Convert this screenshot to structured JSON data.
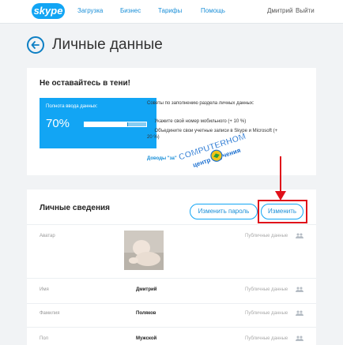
{
  "brand": {
    "logo_text": "skype"
  },
  "nav": {
    "items": [
      "Загрузка",
      "Бизнес",
      "Тарифы",
      "Помощь"
    ],
    "user": "Дмитрий",
    "logout": "Выйти"
  },
  "page": {
    "title": "Личные данные"
  },
  "completion": {
    "heading": "Не оставайтесь в тени!",
    "label": "Полнота ввода данных:",
    "percent_text": "70%",
    "percent": 0.7,
    "tips_title": "Советы по заполнению раздела личных данных:",
    "tips": [
      "Укажите свой номер мобильного (+ 10 %)",
      "Объедините свои учетные записи в Skype и Microsoft (+ 20 %)"
    ],
    "link": "Доводы \"за\""
  },
  "watermark": {
    "line1": "COMPUTERHOM",
    "line2": "центр обучения"
  },
  "profile": {
    "title": "Личные сведения",
    "change_password": "Изменить пароль",
    "edit": "Изменить",
    "rows": [
      {
        "label": "Аватар",
        "value": "",
        "visibility": "Публичные данные"
      },
      {
        "label": "Имя",
        "value": "Дмитрий",
        "visibility": "Публичные данные"
      },
      {
        "label": "Фамилия",
        "value": "Поляков",
        "visibility": "Публичные данные"
      },
      {
        "label": "Пол",
        "value": "Мужской",
        "visibility": "Публичные данные"
      }
    ]
  },
  "colors": {
    "accent": "#12a5f4",
    "highlight": "#e0101a",
    "background": "#f1f3f5"
  }
}
